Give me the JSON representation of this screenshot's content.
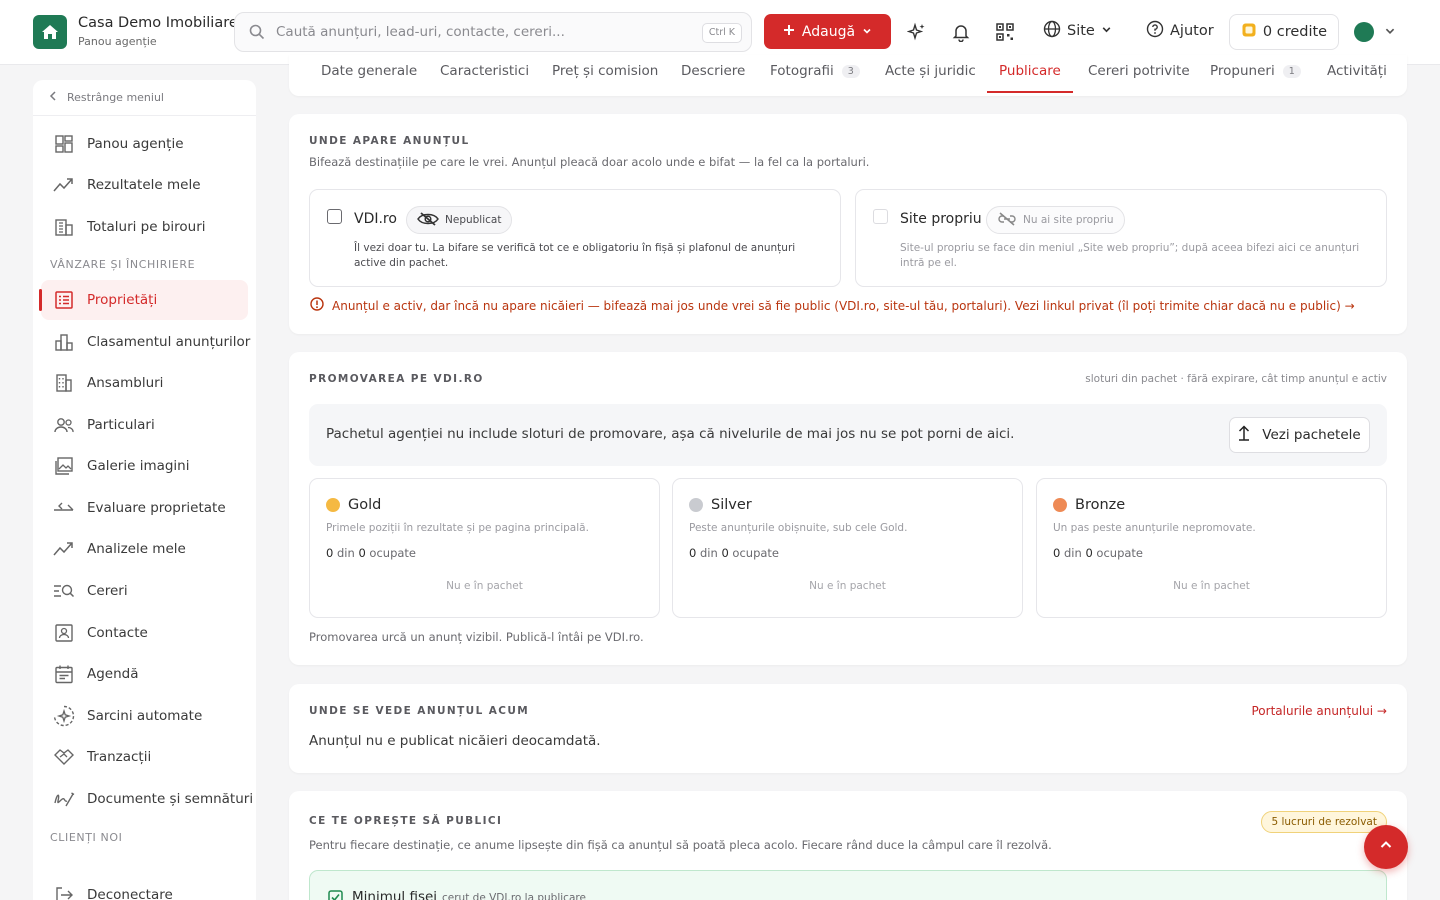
{
  "brand": {
    "title": "Casa Demo Imobiliare",
    "subtitle": "Panou agenție"
  },
  "search": {
    "placeholder": "Caută anunțuri, lead-uri, contacte, cereri...",
    "shortcut": "Ctrl K"
  },
  "header": {
    "add_label": "Adaugă",
    "site_label": "Site",
    "help_label": "Ajutor",
    "credits_label": "0 credite"
  },
  "sidebar": {
    "collapse_label": "Restrânge meniul",
    "items_top": [
      "Panou agenție",
      "Rezultatele mele",
      "Totaluri pe birouri"
    ],
    "section_sale": "VÂNZARE ȘI ÎNCHIRIERE",
    "items_sale": [
      "Proprietăți",
      "Clasamentul anunțurilor",
      "Ansambluri",
      "Particulari",
      "Galerie imagini",
      "Evaluare proprietate",
      "Analizele mele",
      "Cereri",
      "Contacte",
      "Agendă",
      "Sarcini automate",
      "Tranzacții",
      "Documente și semnături"
    ],
    "section_clients": "CLIENȚI NOI",
    "logout": "Deconectare"
  },
  "tabs": [
    {
      "label": "Date generale",
      "count": ""
    },
    {
      "label": "Caracteristici",
      "count": ""
    },
    {
      "label": "Preț și comision",
      "count": ""
    },
    {
      "label": "Descriere",
      "count": ""
    },
    {
      "label": "Fotografii",
      "count": "3"
    },
    {
      "label": "Acte și juridic",
      "count": ""
    },
    {
      "label": "Publicare",
      "count": ""
    },
    {
      "label": "Cereri potrivite",
      "count": ""
    },
    {
      "label": "Propuneri",
      "count": "1"
    },
    {
      "label": "Activități",
      "count": ""
    }
  ],
  "where": {
    "heading": "UNDE APARE ANUNȚUL",
    "subtitle": "Bifează destinațiile pe care le vrei. Anunțul pleacă doar acolo unde e bifat — la fel ca la portaluri.",
    "vdi": {
      "title": "VDI.ro",
      "status": "Nepublicat",
      "desc": "Îl vezi doar tu. La bifare se verifică tot ce e obligatoriu în fișă și plafonul de anunțuri active din pachet."
    },
    "site": {
      "title": "Site propriu",
      "status": "Nu ai site propriu",
      "desc": "Site-ul propriu se face din meniul „Site web propriu”; după aceea bifezi aici ce anunțuri intră pe el."
    },
    "warning": "Anunțul e activ, dar încă nu apare nicăieri — bifează mai jos unde vrei să fie public (VDI.ro, site-ul tău, portaluri). Vezi linkul privat (îl poți trimite chiar dacă nu e public) →"
  },
  "promo": {
    "heading": "PROMOVAREA PE VDI.RO",
    "note": "sloturi din pachet · fără expirare, cât timp anunțul e activ",
    "notice": "Pachetul agenției nu include sloturi de promovare, așa că nivelurile de mai jos nu se pot porni de aici.",
    "packages_btn": "Vezi pachetele",
    "tiers": [
      {
        "name": "Gold",
        "desc": "Primele poziții în rezultate și pe pagina principală.",
        "occ_a": "0",
        "occ_mid": " din ",
        "occ_b": "0",
        "occ_end": " ocupate",
        "status": "Nu e în pachet",
        "color": "#f5b942"
      },
      {
        "name": "Silver",
        "desc": "Peste anunțurile obișnuite, sub cele Gold.",
        "occ_a": "0",
        "occ_mid": " din ",
        "occ_b": "0",
        "occ_end": " ocupate",
        "status": "Nu e în pachet",
        "color": "#c9cbd0"
      },
      {
        "name": "Bronze",
        "desc": "Un pas peste anunțurile nepromovate.",
        "occ_a": "0",
        "occ_mid": " din ",
        "occ_b": "0",
        "occ_end": " ocupate",
        "status": "Nu e în pachet",
        "color": "#ee8a55"
      }
    ],
    "footer": "Promovarea urcă un anunț vizibil. Publică-l întâi pe VDI.ro."
  },
  "where_now": {
    "heading": "UNDE SE VEDE ANUNȚUL ACUM",
    "link": "Portalurile anunțului →",
    "text": "Anunțul nu e publicat nicăieri deocamdată."
  },
  "blockers": {
    "heading": "CE TE OPREȘTE SĂ PUBLICI",
    "badge": "5 lucruri de rezolvat",
    "subtitle": "Pentru fiecare destinație, ce anume lipsește din fișă ca anunțul să poată pleca acolo. Fiecare rând duce la câmpul care îl rezolvă.",
    "min_title": "Minimul fișei",
    "min_sub": "cerut de VDI.ro la publicare"
  },
  "colors": {
    "accent": "#d42a2a",
    "brand_green": "#1f7a55",
    "warning": "#b9350f"
  }
}
